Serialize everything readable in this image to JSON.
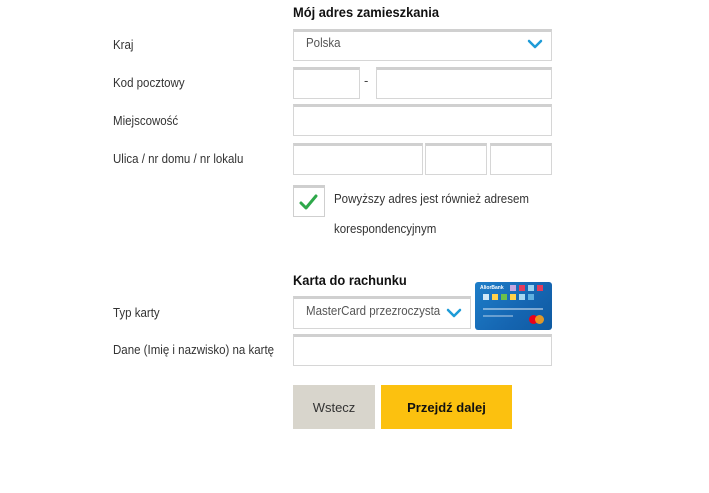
{
  "address": {
    "title": "Mój adres zamieszkania",
    "country": {
      "label": "Kraj",
      "value": "Polska"
    },
    "postal_code": {
      "label": "Kod pocztowy",
      "separator": "-"
    },
    "city": {
      "label": "Miejscowość"
    },
    "street": {
      "label": "Ulica / nr domu / nr lokalu"
    },
    "correspondence": {
      "checked": true,
      "text_line1": "Powyższy adres jest również adresem",
      "text_line2": "korespondencyjnym"
    }
  },
  "card_section": {
    "title": "Karta do rachunku",
    "card_type": {
      "label": "Typ karty",
      "value": "MasterCard przezroczysta"
    },
    "cardholder": {
      "label": "Dane (Imię i nazwisko) na kartę"
    },
    "card_image": {
      "bank_name": "AliorBank"
    }
  },
  "buttons": {
    "back": "Wstecz",
    "next": "Przejdź dalej"
  },
  "colors": {
    "accent": "#fcc10f",
    "back_button": "#d8d5cc",
    "check": "#2ea84a",
    "chevron": "#1e9bd7"
  },
  "icons": {
    "dropdown": "chevron-down-icon",
    "checkbox_mark": "checkmark-icon"
  }
}
